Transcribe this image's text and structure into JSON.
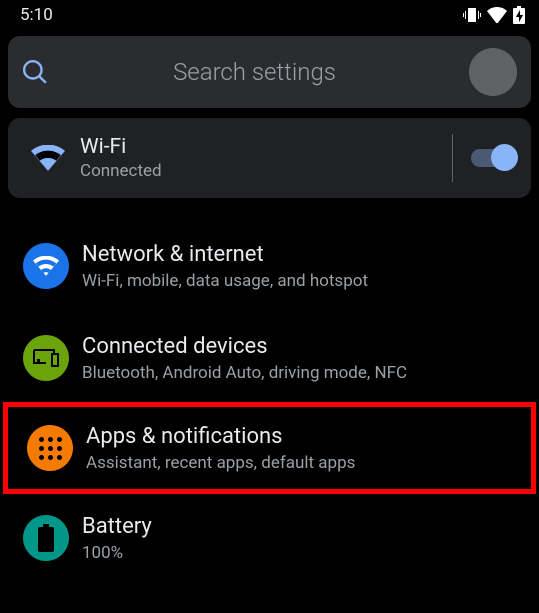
{
  "status": {
    "time": "5:10"
  },
  "search": {
    "placeholder": "Search settings"
  },
  "wifi": {
    "title": "Wi-Fi",
    "subtitle": "Connected"
  },
  "items": {
    "network": {
      "title": "Network & internet",
      "subtitle": "Wi-Fi, mobile, data usage, and hotspot"
    },
    "connected": {
      "title": "Connected devices",
      "subtitle": "Bluetooth, Android Auto, driving mode, NFC"
    },
    "apps": {
      "title": "Apps & notifications",
      "subtitle": "Assistant, recent apps, default apps"
    },
    "battery": {
      "title": "Battery",
      "subtitle": "100%"
    }
  }
}
